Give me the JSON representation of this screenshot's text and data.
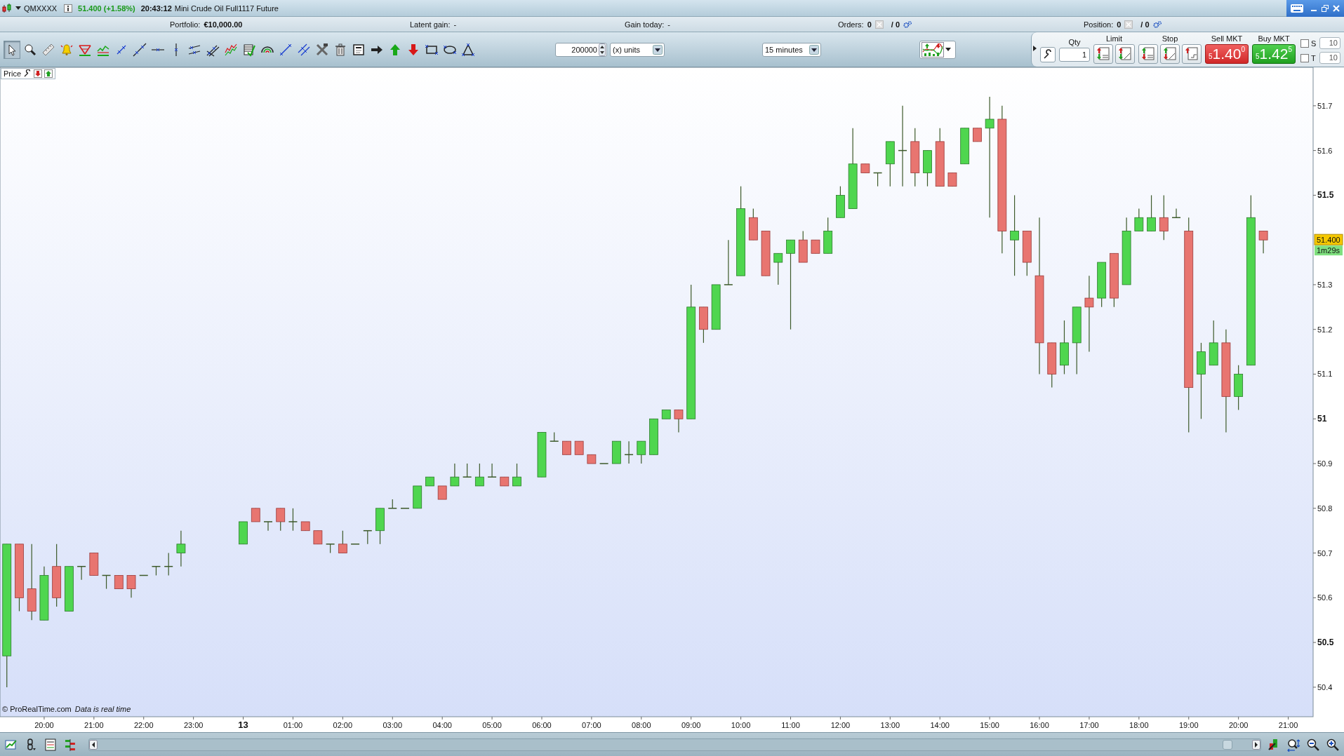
{
  "title_bar": {
    "symbol": "QMXXXX",
    "quote": "51.400 (+1.58%)",
    "time": "20:43:12",
    "instrument": "Mini Crude Oil Full1117 Future"
  },
  "account_bar": {
    "portfolio_label": "Portfolio:",
    "portfolio_value": "€10,000.00",
    "latent_label": "Latent gain:",
    "latent_value": "-",
    "gain_label": "Gain today:",
    "gain_value": "-",
    "orders_label": "Orders:",
    "orders_value": "0",
    "orders_total": "/ 0",
    "position_label": "Position:",
    "position_value": "0",
    "position_total": "/ 0"
  },
  "tools": [
    {
      "selected": true
    },
    {
      "selected": false
    },
    {
      "selected": false
    },
    {
      "selected": false
    },
    {
      "selected": false
    },
    {
      "selected": false
    },
    {
      "selected": false
    },
    {
      "selected": false
    },
    {
      "selected": false
    },
    {
      "selected": false
    },
    {
      "selected": false
    },
    {
      "selected": false
    },
    {
      "selected": false
    },
    {
      "selected": false
    },
    {
      "selected": false
    },
    {
      "selected": false
    },
    {
      "selected": false
    },
    {
      "selected": false
    },
    {
      "selected": false
    },
    {
      "selected": false
    },
    {
      "selected": false
    },
    {
      "selected": false
    },
    {
      "selected": false
    },
    {
      "selected": false
    },
    {
      "selected": false
    },
    {
      "selected": false
    }
  ],
  "quantity": {
    "value": "200000",
    "unit": "(x) units"
  },
  "interval": "15 minutes",
  "trade_panel": {
    "qty_label": "Qty",
    "qty_value": "1",
    "limit_label": "Limit",
    "stop_label": "Stop",
    "sell": {
      "label": "Sell MKT",
      "lead": "5",
      "price": "1.40",
      "pip": "0"
    },
    "buy": {
      "label": "Buy MKT",
      "lead": "5",
      "price": "1.42",
      "pip": "5"
    },
    "options": [
      {
        "label": "S",
        "checked": false,
        "value": "10"
      },
      {
        "label": "T",
        "checked": false,
        "value": "10"
      }
    ]
  },
  "chart": {
    "legend": "Price",
    "copyright": "© ProRealTime.com",
    "notice": "Data is real time",
    "last_price": "51.400",
    "countdown": "1m29s",
    "chart_data": {
      "type": "candlestick",
      "ylim": [
        50.334,
        51.786
      ],
      "categories": [
        null,
        null,
        null,
        "20:00",
        null,
        null,
        null,
        "21:00",
        null,
        null,
        null,
        "22:00",
        null,
        null,
        null,
        "23:00",
        null,
        null,
        null,
        "13",
        null,
        null,
        null,
        "01:00",
        null,
        null,
        null,
        "02:00",
        null,
        null,
        null,
        "03:00",
        null,
        null,
        null,
        "04:00",
        null,
        null,
        null,
        "05:00",
        null,
        null,
        null,
        "06:00",
        null,
        null,
        null,
        "07:00",
        null,
        null,
        null,
        "08:00",
        null,
        null,
        null,
        "09:00",
        null,
        null,
        null,
        "10:00",
        null,
        null,
        null,
        "11:00",
        null,
        null,
        null,
        "12:00",
        null,
        null,
        null,
        "13:00",
        null,
        null,
        null,
        "14:00",
        null,
        null,
        null,
        "15:00",
        null,
        null,
        null,
        "16:00",
        null,
        null,
        null,
        "17:00",
        null,
        null,
        null,
        "18:00",
        null,
        null,
        null,
        "19:00",
        null,
        null,
        null,
        "20:00",
        null,
        null,
        null,
        "21:00"
      ],
      "ohlc": [
        [
          50.47,
          50.72,
          50.4,
          50.72
        ],
        [
          50.72,
          50.72,
          50.57,
          50.6
        ],
        [
          50.62,
          50.72,
          50.55,
          50.57
        ],
        [
          50.55,
          50.67,
          50.55,
          50.65
        ],
        [
          50.67,
          50.72,
          50.58,
          50.6
        ],
        [
          50.57,
          50.67,
          50.57,
          50.67
        ],
        [
          50.67,
          50.67,
          50.64,
          50.67
        ],
        [
          50.7,
          50.7,
          50.65,
          50.65
        ],
        [
          50.65,
          50.65,
          50.62,
          50.65
        ],
        [
          50.65,
          50.65,
          50.62,
          50.62
        ],
        [
          50.65,
          50.65,
          50.6,
          50.62
        ],
        [
          50.65,
          50.65,
          50.65,
          50.65
        ],
        [
          50.67,
          50.67,
          50.65,
          50.67
        ],
        [
          50.67,
          50.7,
          50.65,
          50.67
        ],
        [
          50.7,
          50.75,
          50.67,
          50.72
        ],
        null,
        null,
        null,
        null,
        [
          50.72,
          50.77,
          50.72,
          50.77
        ],
        [
          50.8,
          50.8,
          50.77,
          50.77
        ],
        [
          50.77,
          50.77,
          50.75,
          50.77
        ],
        [
          50.8,
          50.8,
          50.75,
          50.77
        ],
        [
          50.77,
          50.8,
          50.75,
          50.77
        ],
        [
          50.77,
          50.77,
          50.75,
          50.75
        ],
        [
          50.75,
          50.75,
          50.72,
          50.72
        ],
        [
          50.72,
          50.72,
          50.7,
          50.72
        ],
        [
          50.72,
          50.75,
          50.7,
          50.7
        ],
        [
          50.72,
          50.72,
          50.72,
          50.72
        ],
        [
          50.75,
          50.75,
          50.72,
          50.75
        ],
        [
          50.75,
          50.8,
          50.72,
          50.8
        ],
        [
          50.8,
          50.82,
          50.8,
          50.8
        ],
        [
          50.8,
          50.8,
          50.8,
          50.8
        ],
        [
          50.8,
          50.85,
          50.8,
          50.85
        ],
        [
          50.85,
          50.87,
          50.85,
          50.87
        ],
        [
          50.85,
          50.85,
          50.82,
          50.82
        ],
        [
          50.85,
          50.9,
          50.85,
          50.87
        ],
        [
          50.87,
          50.9,
          50.87,
          50.87
        ],
        [
          50.85,
          50.9,
          50.85,
          50.87
        ],
        [
          50.87,
          50.9,
          50.87,
          50.87
        ],
        [
          50.87,
          50.87,
          50.85,
          50.85
        ],
        [
          50.85,
          50.9,
          50.85,
          50.87
        ],
        null,
        [
          50.87,
          50.97,
          50.87,
          50.97
        ],
        [
          50.95,
          50.97,
          50.95,
          50.95
        ],
        [
          50.95,
          50.95,
          50.92,
          50.92
        ],
        [
          50.95,
          50.95,
          50.92,
          50.92
        ],
        [
          50.92,
          50.92,
          50.9,
          50.9
        ],
        [
          50.9,
          50.9,
          50.9,
          50.9
        ],
        [
          50.9,
          50.95,
          50.9,
          50.95
        ],
        [
          50.92,
          50.95,
          50.9,
          50.92
        ],
        [
          50.92,
          50.95,
          50.9,
          50.95
        ],
        [
          50.92,
          51.0,
          50.92,
          51.0
        ],
        [
          51.0,
          51.02,
          51.0,
          51.02
        ],
        [
          51.02,
          51.02,
          50.97,
          51.0
        ],
        [
          51.0,
          51.3,
          51.0,
          51.25
        ],
        [
          51.25,
          51.25,
          51.17,
          51.2
        ],
        [
          51.2,
          51.3,
          51.2,
          51.3
        ],
        [
          51.3,
          51.4,
          51.3,
          51.3
        ],
        [
          51.32,
          51.52,
          51.32,
          51.47
        ],
        [
          51.45,
          51.47,
          51.4,
          51.4
        ],
        [
          51.42,
          51.42,
          51.32,
          51.32
        ],
        [
          51.35,
          51.37,
          51.3,
          51.37
        ],
        [
          51.37,
          51.4,
          51.2,
          51.4
        ],
        [
          51.4,
          51.42,
          51.35,
          51.35
        ],
        [
          51.4,
          51.4,
          51.37,
          51.37
        ],
        [
          51.37,
          51.45,
          51.37,
          51.42
        ],
        [
          51.45,
          51.52,
          51.45,
          51.5
        ],
        [
          51.47,
          51.65,
          51.47,
          51.57
        ],
        [
          51.57,
          51.57,
          51.55,
          51.55
        ],
        [
          51.55,
          51.55,
          51.52,
          51.55
        ],
        [
          51.57,
          51.62,
          51.52,
          51.62
        ],
        [
          51.6,
          51.7,
          51.52,
          51.6
        ],
        [
          51.62,
          51.65,
          51.52,
          51.55
        ],
        [
          51.55,
          51.6,
          51.52,
          51.6
        ],
        [
          51.62,
          51.65,
          51.52,
          51.52
        ],
        [
          51.55,
          51.55,
          51.52,
          51.52
        ],
        [
          51.57,
          51.65,
          51.57,
          51.65
        ],
        [
          51.65,
          51.65,
          51.62,
          51.62
        ],
        [
          51.65,
          51.72,
          51.45,
          51.67
        ],
        [
          51.67,
          51.7,
          51.37,
          51.42
        ],
        [
          51.4,
          51.5,
          51.32,
          51.42
        ],
        [
          51.42,
          51.42,
          51.32,
          51.35
        ],
        [
          51.32,
          51.45,
          51.1,
          51.17
        ],
        [
          51.17,
          51.17,
          51.07,
          51.1
        ],
        [
          51.12,
          51.22,
          51.1,
          51.17
        ],
        [
          51.17,
          51.25,
          51.1,
          51.25
        ],
        [
          51.27,
          51.32,
          51.15,
          51.25
        ],
        [
          51.27,
          51.35,
          51.25,
          51.35
        ],
        [
          51.37,
          51.37,
          51.25,
          51.27
        ],
        [
          51.3,
          51.45,
          51.3,
          51.42
        ],
        [
          51.42,
          51.47,
          51.42,
          51.45
        ],
        [
          51.42,
          51.5,
          51.42,
          51.45
        ],
        [
          51.45,
          51.5,
          51.4,
          51.42
        ],
        [
          51.45,
          51.47,
          51.45,
          51.45
        ],
        [
          51.42,
          51.45,
          50.97,
          51.07
        ],
        [
          51.1,
          51.17,
          51.0,
          51.15
        ],
        [
          51.12,
          51.22,
          51.12,
          51.17
        ],
        [
          51.17,
          51.2,
          50.97,
          51.05
        ],
        [
          51.05,
          51.12,
          51.02,
          51.1
        ],
        [
          51.12,
          51.5,
          51.12,
          51.45
        ],
        [
          51.42,
          51.42,
          51.37,
          51.4
        ],
        null,
        null
      ],
      "yticks": [
        50.4,
        50.5,
        50.6,
        50.7,
        50.8,
        50.9,
        51,
        51.1,
        51.2,
        51.3,
        51.5,
        51.6,
        51.7
      ]
    }
  }
}
